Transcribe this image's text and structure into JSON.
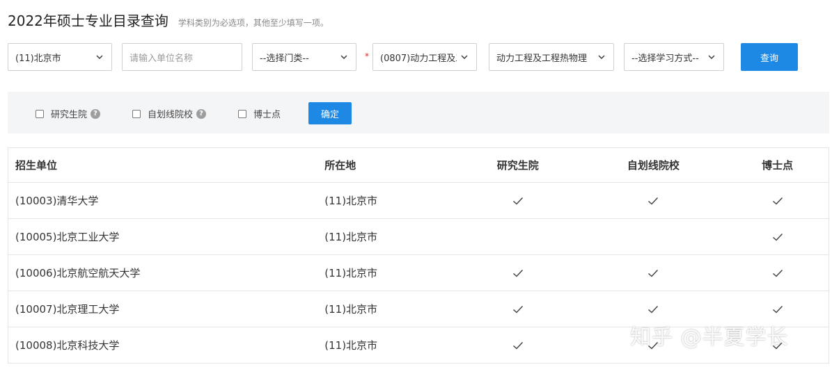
{
  "header": {
    "title": "2022年硕士专业目录查询",
    "hint": "学科类别为必选项，其他至少填写一项。"
  },
  "search": {
    "region_value": "(11)北京市",
    "unit_placeholder": "请输入单位名称",
    "category_value": "--选择门类--",
    "required_mark": "*",
    "discipline_value": "(0807)动力工程及工",
    "major_value": "动力工程及工程热物理",
    "study_mode_value": "--选择学习方式--",
    "query_label": "查询"
  },
  "filters": {
    "items": [
      {
        "label": "研究生院",
        "help": "?"
      },
      {
        "label": "自划线院校",
        "help": "?"
      },
      {
        "label": "博士点"
      }
    ],
    "confirm_label": "确定"
  },
  "table": {
    "headers": [
      "招生单位",
      "所在地",
      "研究生院",
      "自划线院校",
      "博士点"
    ],
    "rows": [
      {
        "unit": "(10003)清华大学",
        "location": "(11)北京市",
        "grad": true,
        "self": true,
        "phd": true
      },
      {
        "unit": "(10005)北京工业大学",
        "location": "(11)北京市",
        "grad": false,
        "self": false,
        "phd": true
      },
      {
        "unit": "(10006)北京航空航天大学",
        "location": "(11)北京市",
        "grad": true,
        "self": true,
        "phd": true
      },
      {
        "unit": "(10007)北京理工大学",
        "location": "(11)北京市",
        "grad": true,
        "self": true,
        "phd": true
      },
      {
        "unit": "(10008)北京科技大学",
        "location": "(11)北京市",
        "grad": true,
        "self": true,
        "phd": true
      }
    ]
  },
  "watermark": "知乎 @半夏学长",
  "colors": {
    "accent": "#1e88e5",
    "required": "#e02020",
    "filter_bg": "#f4f5f7"
  },
  "icons": {
    "select": "chevron-down-icon",
    "help": "question-circle-icon",
    "check": "check-icon"
  }
}
